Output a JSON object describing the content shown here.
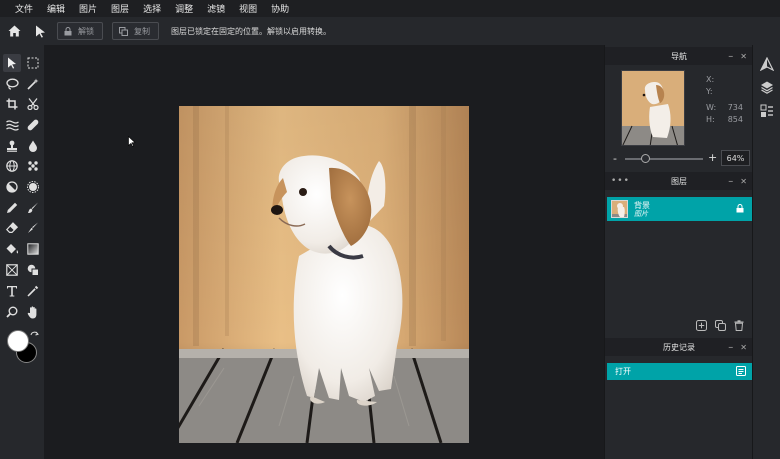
{
  "menubar": {
    "items": [
      "文件",
      "编辑",
      "图片",
      "图层",
      "选择",
      "调整",
      "滤镜",
      "视图",
      "协助"
    ]
  },
  "options_bar": {
    "unlock_label": "解锁",
    "duplicate_label": "复制",
    "message": "图层已锁定在固定的位置。解锁以启用转换。"
  },
  "navigator": {
    "title": "导航",
    "x_label": "X:",
    "y_label": "Y:",
    "w_label": "W:",
    "h_label": "H:",
    "w_value": "734",
    "h_value": "854",
    "zoom_minus": "-",
    "zoom_plus": "+",
    "zoom_value": "64%"
  },
  "layers": {
    "title": "图层",
    "dots": "•••",
    "items": [
      {
        "name": "背景",
        "type": "图片"
      }
    ]
  },
  "history": {
    "title": "历史记录",
    "items": [
      "打开"
    ]
  },
  "panel_controls": {
    "minimize": "–",
    "close": "✕"
  },
  "colors": {
    "accent": "#00a3a8",
    "foreground_swatch": "#ffffff",
    "background_swatch": "#000000"
  }
}
